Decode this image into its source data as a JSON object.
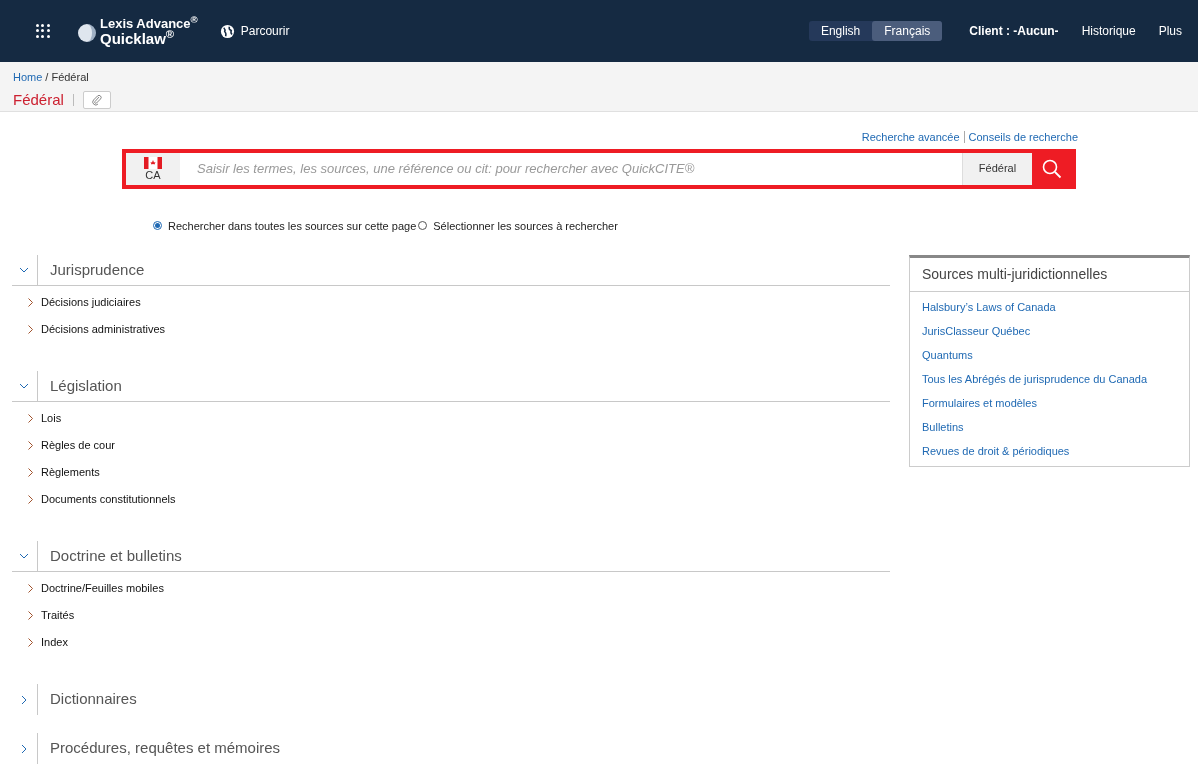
{
  "header": {
    "logo_line1": "Lexis Advance$^{®}$",
    "logo_line2": "Quicklaw$^{®}$",
    "browse": "Parcourir",
    "languages": [
      {
        "label": "English",
        "selected": false
      },
      {
        "label": "Français",
        "selected": true
      }
    ],
    "client": "Client : -Aucun-",
    "nav": [
      "Historique",
      "Plus"
    ]
  },
  "breadcrumb": [
    {
      "kind": "link",
      "label": "Home"
    },
    {
      "kind": "separator",
      "label": "/"
    },
    {
      "kind": "current",
      "label": "Fédéral"
    }
  ],
  "page_title": "Fédéral",
  "search": {
    "links": [
      "Recherche avancée",
      "Conseils de recherche"
    ],
    "country": "CA",
    "placeholder": "Saisir les termes, les sources, une référence ou cit: pour rechercher avec QuickCITE®",
    "scope": "Fédéral"
  },
  "search_options": [
    {
      "label": "Rechercher dans toutes les sources sur cette page",
      "selected": true
    },
    {
      "label": "Sélectionner les sources à rechercher",
      "selected": false
    }
  ],
  "sections": [
    {
      "title": "Jurisprudence",
      "expanded": true,
      "items": [
        "Décisions judiciaires",
        "Décisions administratives"
      ]
    },
    {
      "title": "Législation",
      "expanded": true,
      "items": [
        "Lois",
        "Règles de cour",
        "Règlements",
        "Documents constitutionnels"
      ]
    },
    {
      "title": "Doctrine et bulletins",
      "expanded": true,
      "items": [
        "Doctrine/Feuilles mobiles",
        "Traités",
        "Index"
      ]
    },
    {
      "title": "Dictionnaires",
      "expanded": false
    },
    {
      "title": "Procédures, requêtes et mémoires",
      "expanded": false
    }
  ],
  "multi_sources": {
    "title": "Sources multi-juridictionnelles",
    "links": [
      "Halsbury’s Laws of Canada",
      "JurisClasseur Québec",
      "Quantums",
      "Tous les Abrégés de jurisprudence du Canada",
      "Formulaires et modèles",
      "Bulletins",
      "Revues de droit & périodiques"
    ]
  }
}
